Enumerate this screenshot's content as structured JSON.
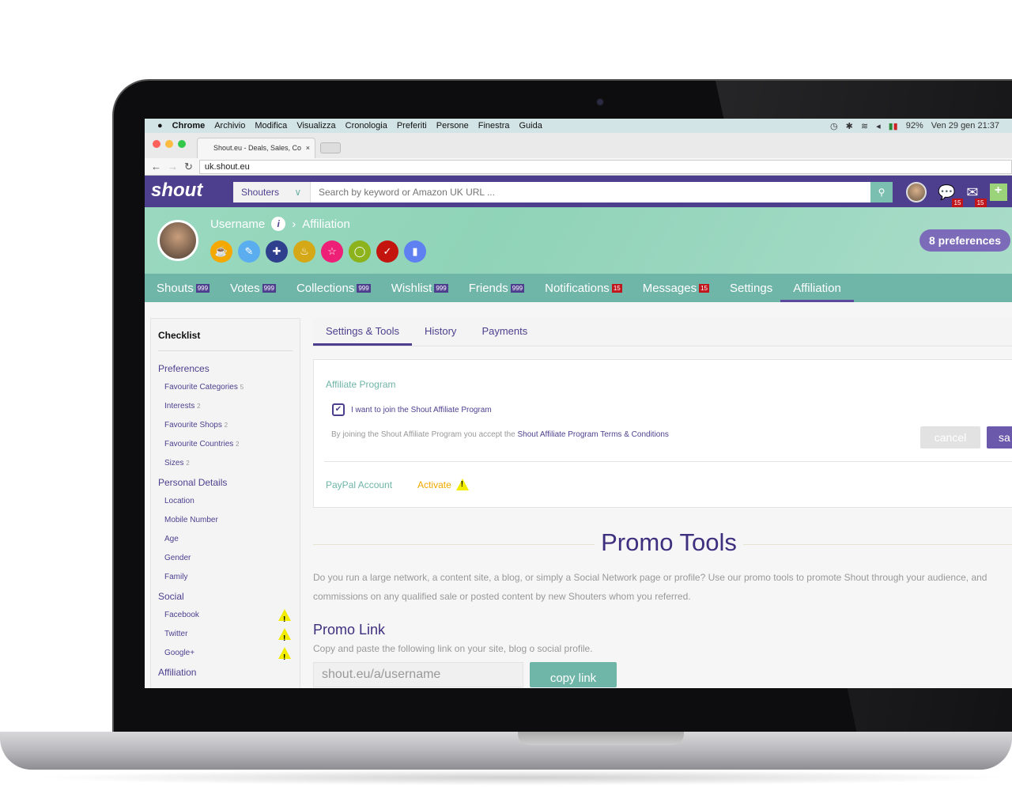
{
  "macos": {
    "apple": "",
    "app": "Chrome",
    "menus": [
      "Archivio",
      "Modifica",
      "Visualizza",
      "Cronologia",
      "Preferiti",
      "Persone",
      "Finestra",
      "Guida"
    ],
    "battery": "92%",
    "datetime": "Ven 29 gen  21:37"
  },
  "browser": {
    "tab_title": "Shout.eu - Deals, Sales, Co",
    "url": "uk.shout.eu"
  },
  "header": {
    "logo": "shout",
    "search_scope": "Shouters",
    "search_placeholder": "Search by keyword or Amazon UK URL ...",
    "notif_count": "15",
    "mail_count": "15"
  },
  "profile": {
    "username": "Username",
    "section": "Affiliation",
    "preferences_label": "8 preferences",
    "badge_colors": [
      "#f5a800",
      "#5aaef0",
      "#2e3f8e",
      "#d4a817",
      "#ee1f77",
      "#8cb21c",
      "#c4140e",
      "#5f80f0"
    ]
  },
  "nav": [
    {
      "label": "Shouts",
      "count": "999"
    },
    {
      "label": "Votes",
      "count": "999"
    },
    {
      "label": "Collections",
      "count": "999"
    },
    {
      "label": "Wishlist",
      "count": "999"
    },
    {
      "label": "Friends",
      "count": "999"
    },
    {
      "label": "Notifications",
      "count": "15"
    },
    {
      "label": "Messages",
      "count": "15"
    },
    {
      "label": "Settings",
      "count": ""
    },
    {
      "label": "Affiliation",
      "count": ""
    }
  ],
  "sidebar": {
    "title": "Checklist",
    "groups": [
      {
        "label": "Preferences",
        "items": [
          {
            "label": "Favourite Categories",
            "count": "5"
          },
          {
            "label": "Interests",
            "count": "2"
          },
          {
            "label": "Favourite Shops",
            "count": "2"
          },
          {
            "label": "Favourite Countries",
            "count": "2"
          },
          {
            "label": "Sizes",
            "count": "2"
          }
        ]
      },
      {
        "label": "Personal Details",
        "items": [
          {
            "label": "Location"
          },
          {
            "label": "Mobile Number"
          },
          {
            "label": "Age"
          },
          {
            "label": "Gender"
          },
          {
            "label": "Family"
          }
        ]
      },
      {
        "label": "Social",
        "items": [
          {
            "label": "Facebook",
            "warn": true
          },
          {
            "label": "Twitter",
            "warn": true
          },
          {
            "label": "Google+",
            "warn": true
          }
        ]
      },
      {
        "label": "Affiliation",
        "items": []
      }
    ]
  },
  "subtabs": [
    "Settings & Tools",
    "History",
    "Payments"
  ],
  "affiliate": {
    "title": "Affiliate Program",
    "checkbox_label": "I want to join the Shout Affiliate Program",
    "checked": true,
    "terms_prefix": "By joining the Shout Affiliate Program you accept the",
    "terms_link": "Shout Affiliate Program Terms & Conditions",
    "cancel": "cancel",
    "save": "sa",
    "paypal_label": "PayPal Account",
    "activate": "Activate"
  },
  "promo": {
    "title": "Promo Tools",
    "desc1": "Do you run a large network, a content site, a blog, or simply a Social Network page or profile? Use our promo tools to promote Shout through your audience, and",
    "desc2": "commissions on any qualified sale or posted content by new Shouters whom you referred.",
    "link_title": "Promo Link",
    "link_sub": "Copy and paste the following link on your site, blog o social profile.",
    "link_value": "shout.eu/a/username",
    "copy": "copy link"
  }
}
